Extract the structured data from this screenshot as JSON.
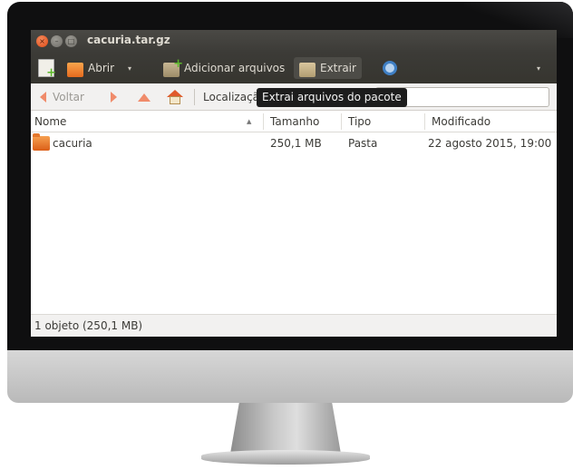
{
  "window": {
    "title": "cacuria.tar.gz",
    "controls": {
      "close": "×",
      "minimize": "–",
      "maximize": "□"
    }
  },
  "toolbar": {
    "new_icon": "new-archive-icon",
    "open_label": "Abrir",
    "open_dropdown": "▾",
    "add_files_label": "Adicionar arquivos",
    "extract_label": "Extrair",
    "search_icon": "search-icon",
    "menu_dropdown": "▾"
  },
  "location": {
    "back_label": "Voltar",
    "label": "Localização:",
    "value": ""
  },
  "tooltip": {
    "text": "Extrai arquivos do pacote"
  },
  "columns": {
    "name": "Nome",
    "size": "Tamanho",
    "type": "Tipo",
    "modified": "Modificado"
  },
  "files": [
    {
      "name": "cacuria",
      "size": "250,1 MB",
      "type": "Pasta",
      "modified": "22 agosto 2015, 19:00",
      "icon": "folder-icon"
    }
  ],
  "statusbar": {
    "text": "1 objeto (250,1 MB)"
  },
  "colors": {
    "titlebar": "#3c3b37",
    "accent_orange": "#f08b6a",
    "close_button": "#df4a16"
  }
}
